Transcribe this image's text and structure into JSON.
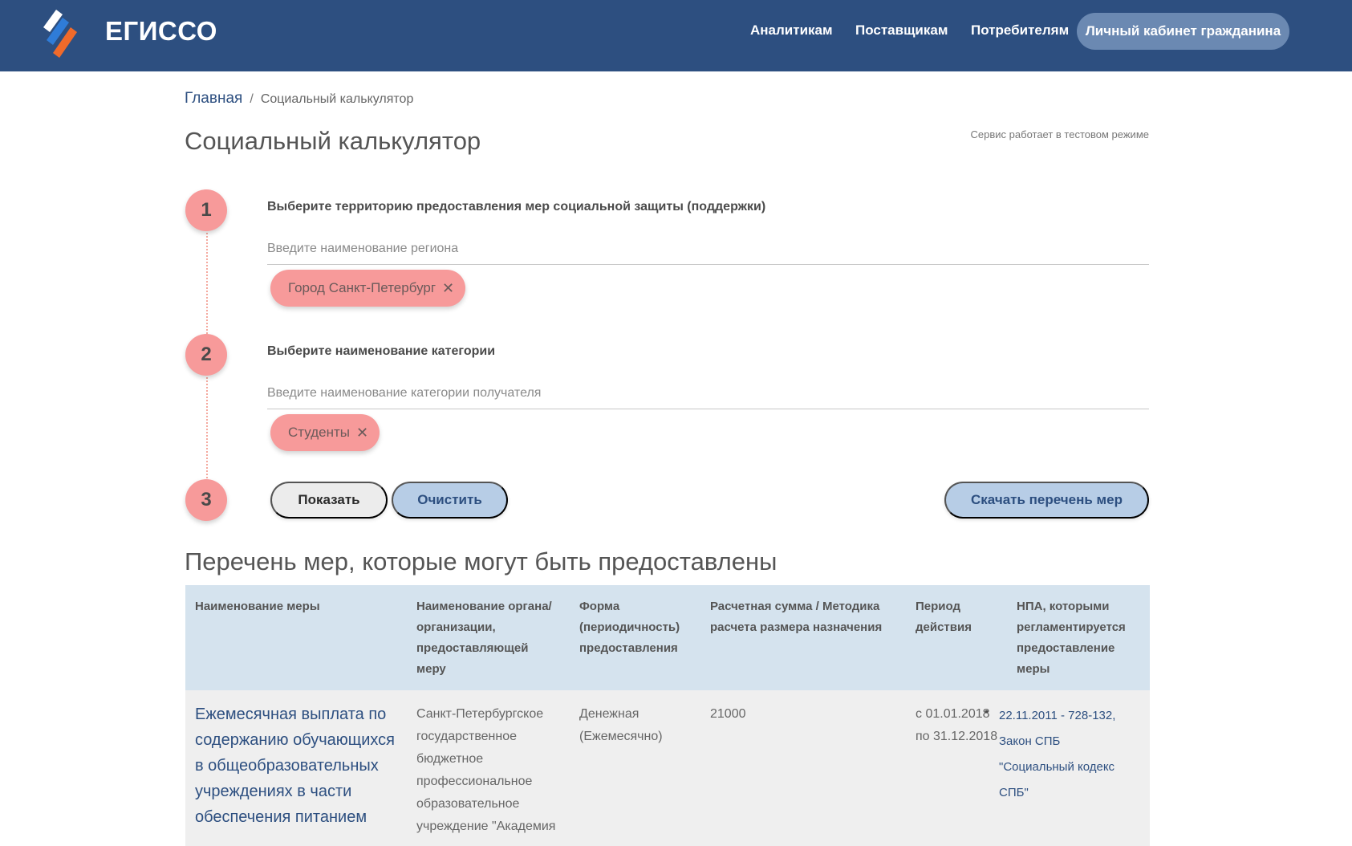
{
  "header": {
    "logo_text": "ЕГИССО",
    "nav": [
      "Аналитикам",
      "Поставщикам",
      "Потребителям"
    ],
    "cabinet_label": "Личный кабинет гражданина"
  },
  "breadcrumb": {
    "home": "Главная",
    "separator": "/",
    "current": "Социальный калькулятор"
  },
  "page": {
    "title": "Социальный калькулятор",
    "test_note": "Сервис работает в тестовом режиме"
  },
  "steps": [
    {
      "number": "1",
      "label": "Выберите территорию предоставления мер социальной защиты (поддержки)",
      "placeholder": "Введите наименование региона",
      "chip": "Город Санкт-Петербург"
    },
    {
      "number": "2",
      "label": "Выберите наименование категории",
      "placeholder": "Введите наименование категории получателя",
      "chip": "Студенты"
    },
    {
      "number": "3"
    }
  ],
  "chip_close_glyph": "✕",
  "buttons": {
    "show": "Показать",
    "clear": "Очистить",
    "download": "Скачать перечень мер"
  },
  "results": {
    "title": "Перечень мер, которые могут быть предоставлены",
    "columns": [
      "Наименование меры",
      "Наименование органа/организации, предоставляющей меру",
      "Форма (периодичность) предоставления",
      "Расчетная сумма / Методика расчета размера назначения",
      "Период действия",
      "НПА, которыми регламентируется предоставление меры"
    ],
    "rows": [
      {
        "measure": "Ежемесячная выплата по содержанию обучающихся в общеобразовательных учреждениях в части обеспечения питанием",
        "organization": "Санкт-Петербургское государственное бюджетное профессиональное образовательное учреждение \"Академия",
        "form": "Денежная (Ежемесячно)",
        "amount": "21000",
        "period": "с 01.01.2018 по 31.12.2018",
        "npa": "22.11.2011 - 728-132, Закон СПБ \"Социальный кодекс СПБ\""
      }
    ]
  },
  "colors": {
    "header_bg": "#2d4f80",
    "accent_pink": "#f79a9a",
    "button_blue": "#b7cde6",
    "table_header_bg": "#d5e3ee"
  }
}
